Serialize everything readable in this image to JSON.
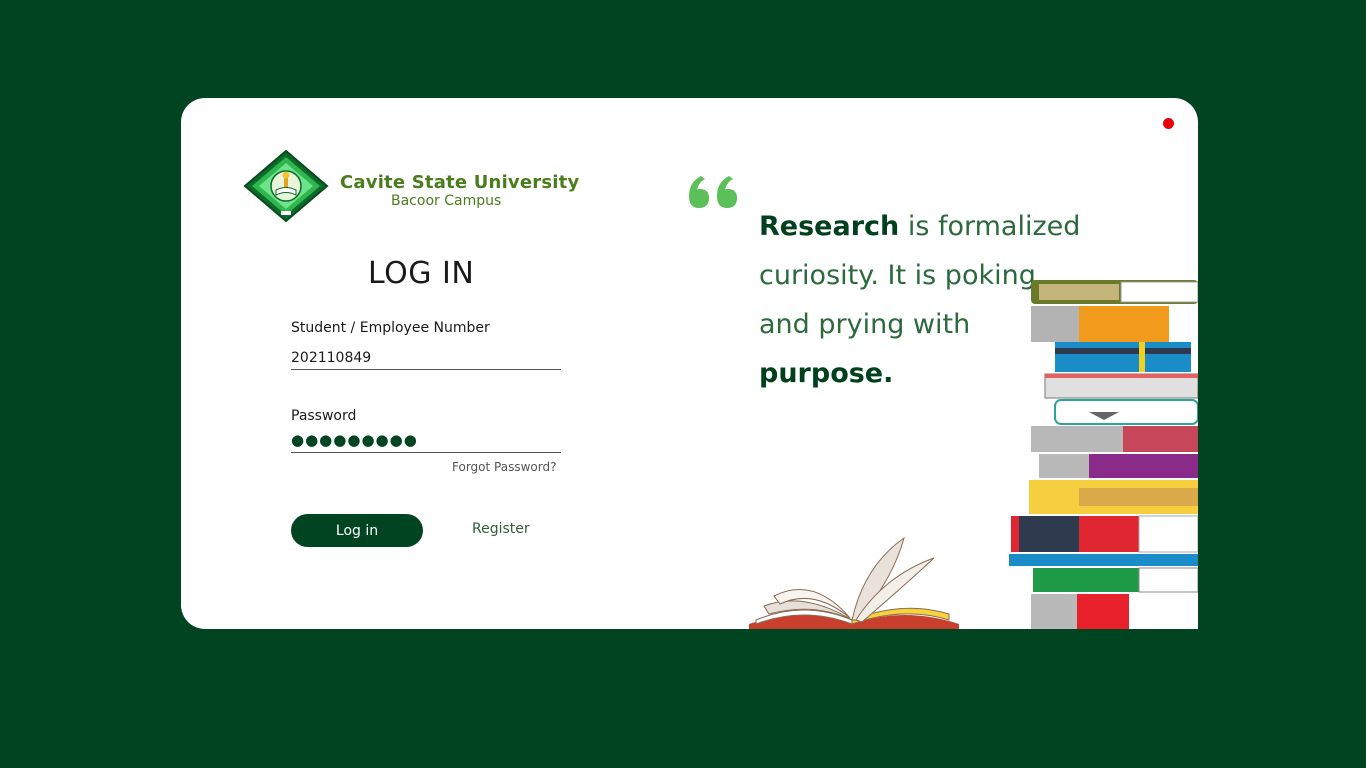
{
  "brand": {
    "university": "Cavite State University",
    "campus": "Bacoor Campus",
    "logo_icon": "cvsu-seal-icon"
  },
  "login": {
    "title": "LOG IN",
    "id_label": "Student / Employee Number",
    "id_value": "202110849",
    "password_label": "Password",
    "password_mask": "●●●●●●●●●",
    "forgot_label": "Forgot Password?",
    "login_button": "Log in",
    "register_link": "Register"
  },
  "quote": {
    "emphasis_start": "Research",
    "middle": " is formalized curiosity. It is poking and prying with ",
    "emphasis_end": "purpose."
  },
  "colors": {
    "background": "#004422",
    "accent": "#004422",
    "brand_green": "#4a7d1b",
    "quote_mark": "#5cc05a",
    "status_dot": "#e8000b"
  }
}
